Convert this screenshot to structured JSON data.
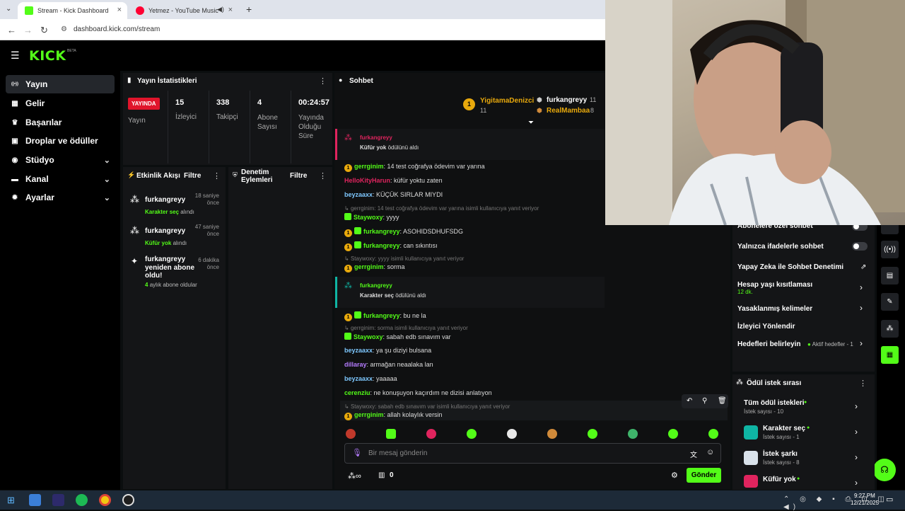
{
  "browser": {
    "tabs": [
      {
        "label": "Stream - Kick Dashboard",
        "active": true
      },
      {
        "label": "Yetmez - YouTube Music",
        "active": false
      }
    ],
    "url": "dashboard.kick.com/stream",
    "new_tab": "+",
    "close": "×",
    "back": "←",
    "forward": "→",
    "reload": "↻"
  },
  "kick": {
    "logo": "KICK",
    "beta": "BETA",
    "accent": "#53fc18"
  },
  "sidebar": {
    "items": [
      {
        "label": "Yayın",
        "icon": "broadcast-icon",
        "glyph": "((•))",
        "active": true
      },
      {
        "label": "Gelir",
        "icon": "revenue-icon",
        "glyph": "▦"
      },
      {
        "label": "Başarılar",
        "icon": "trophy-icon",
        "glyph": "♛"
      },
      {
        "label": "Droplar ve ödüller",
        "icon": "gift-icon",
        "glyph": "▣"
      },
      {
        "label": "Stüdyo",
        "icon": "studio-icon",
        "glyph": "◉",
        "chevron": "⌄"
      },
      {
        "label": "Kanal",
        "icon": "channel-icon",
        "glyph": "▬",
        "chevron": "⌄"
      },
      {
        "label": "Ayarlar",
        "icon": "settings-icon",
        "glyph": "✹",
        "chevron": "⌄"
      }
    ]
  },
  "stats": {
    "title": "Yayın İstatistikleri",
    "live_badge": "YAYINDA",
    "items": [
      {
        "label": "Yayın",
        "value": ""
      },
      {
        "label": "İzleyici",
        "value": "15"
      },
      {
        "label": "Takipçi",
        "value": "338"
      },
      {
        "label": "Abone Sayısı",
        "value": "4"
      },
      {
        "label": "Yayında Olduğu Süre",
        "value": "00:24:57"
      }
    ]
  },
  "activity": {
    "title": "Etkinlik Akışı",
    "filter": "Filtre",
    "items": [
      {
        "user": "furkangreyy",
        "reward": "Karakter seç",
        "suffix": "alındı",
        "time": "18 saniye önce"
      },
      {
        "user": "furkangreyy",
        "reward": "Küfür yok",
        "suffix": "alındı",
        "time": "47 saniye önce"
      },
      {
        "user": "furkangreyy yeniden abone oldu!",
        "reward": "4",
        "suffix": "aylık abone oldular",
        "time": "6 dakika önce"
      }
    ]
  },
  "moderation": {
    "title": "Denetim Eylemleri",
    "filter": "Filtre"
  },
  "chat": {
    "title": "Sohbet",
    "leaderboard": [
      {
        "name": "YigitamaDenizci",
        "count": "11"
      },
      {
        "name": "furkangreyy",
        "count": "11"
      },
      {
        "name": "RealMambaa",
        "count": "8"
      }
    ],
    "reward_events": [
      {
        "user": "furkangreyy",
        "reward": "Küfür yok",
        "text": "ödülünü aldı"
      },
      {
        "user": "furkangreyy",
        "reward": "Karakter seç",
        "text": "ödülünü aldı"
      }
    ],
    "messages": [
      {
        "user": "gerrginim",
        "text": "14 test coğrafya ödevim var yarına",
        "color": "#53fc18"
      },
      {
        "user": "HelloKityHarun",
        "text": "küfür yoktu zaten",
        "color": "#e0245e"
      },
      {
        "user": "beyzaaxx",
        "text": "KÜÇÜK SIRLAR MIYDI",
        "color": "#7ec8ff"
      },
      {
        "reply": "gerrginim: 14 test coğrafya ödevim var yarına isimli kullanıcıya yanıt veriyor"
      },
      {
        "user": "Staywoxy",
        "text": "yyyy",
        "color": "#53fc18"
      },
      {
        "user": "furkangreyy",
        "text": "ASOHIDSDHUFSDG",
        "color": "#53fc18"
      },
      {
        "user": "furkangreyy",
        "text": "can sıkıntısı",
        "color": "#53fc18"
      },
      {
        "reply": "Staywoxy: yyyy isimli kullanıcıya yanıt veriyor"
      },
      {
        "user": "gerrginim",
        "text": "sorma",
        "color": "#53fc18"
      },
      {
        "user": "furkangreyy",
        "text": "bu ne la",
        "color": "#53fc18"
      },
      {
        "reply": "gerrginim: sorma isimli kullanıcıya yanıt veriyor"
      },
      {
        "user": "Staywoxy",
        "text": "sabah edb sınavım var",
        "color": "#53fc18"
      },
      {
        "user": "beyzaaxx",
        "text": "ya şu diziyi bulsana",
        "color": "#7ec8ff"
      },
      {
        "user": "dillaray",
        "text": "armağan neaalaka lan",
        "color": "#b57cff"
      },
      {
        "user": "beyzaaxx",
        "text": "yaaaaa",
        "color": "#7ec8ff"
      },
      {
        "user": "cerenziu",
        "text": "ne konuşuyon kaçırdım ne dizisi anlatıyon",
        "color": "#53fc18"
      },
      {
        "reply": "Staywoxy: sabah edb sınavım var isimli kullanıcıya yanıt veriyor"
      },
      {
        "user": "gerrginim",
        "text": "allah kolaylık versin",
        "color": "#53fc18"
      }
    ],
    "input_placeholder": "Bir mesaj gönderin",
    "send": "Gönder",
    "points": "0"
  },
  "settings": {
    "items": [
      {
        "label": "Abonelere özel sohbet",
        "type": "toggle"
      },
      {
        "label": "Yalnızca ifadelerle sohbet",
        "type": "toggle"
      },
      {
        "label": "Yapay Zeka ile Sohbet Denetimi",
        "type": "external"
      },
      {
        "label": "Hesap yaşı kısıtlaması",
        "sub": "12 dk.",
        "type": "chevron"
      },
      {
        "label": "Yasaklanmış kelimeler",
        "type": "chevron"
      },
      {
        "label": "İzleyici Yönlendir",
        "type": "none"
      },
      {
        "label": "Hedefleri belirleyin",
        "extra": "Aktif hedefler - 1",
        "type": "chevron"
      }
    ]
  },
  "rewards": {
    "title": "Ödül istek sırası",
    "items": [
      {
        "label": "Tüm ödül istekleri",
        "sub": "İstek sayısı - 10",
        "color": ""
      },
      {
        "label": "Karakter seç",
        "sub": "İstek sayısı - 1",
        "color": "#0fb5a4"
      },
      {
        "label": "İstek şarkı",
        "sub": "İstek sayısı - 8",
        "color": "#d9e2ea"
      },
      {
        "label": "Küfür yok",
        "sub": "",
        "color": "#e0245e"
      }
    ]
  },
  "taskbar": {
    "time": "9:27 PM",
    "date": "12/21/2025"
  }
}
